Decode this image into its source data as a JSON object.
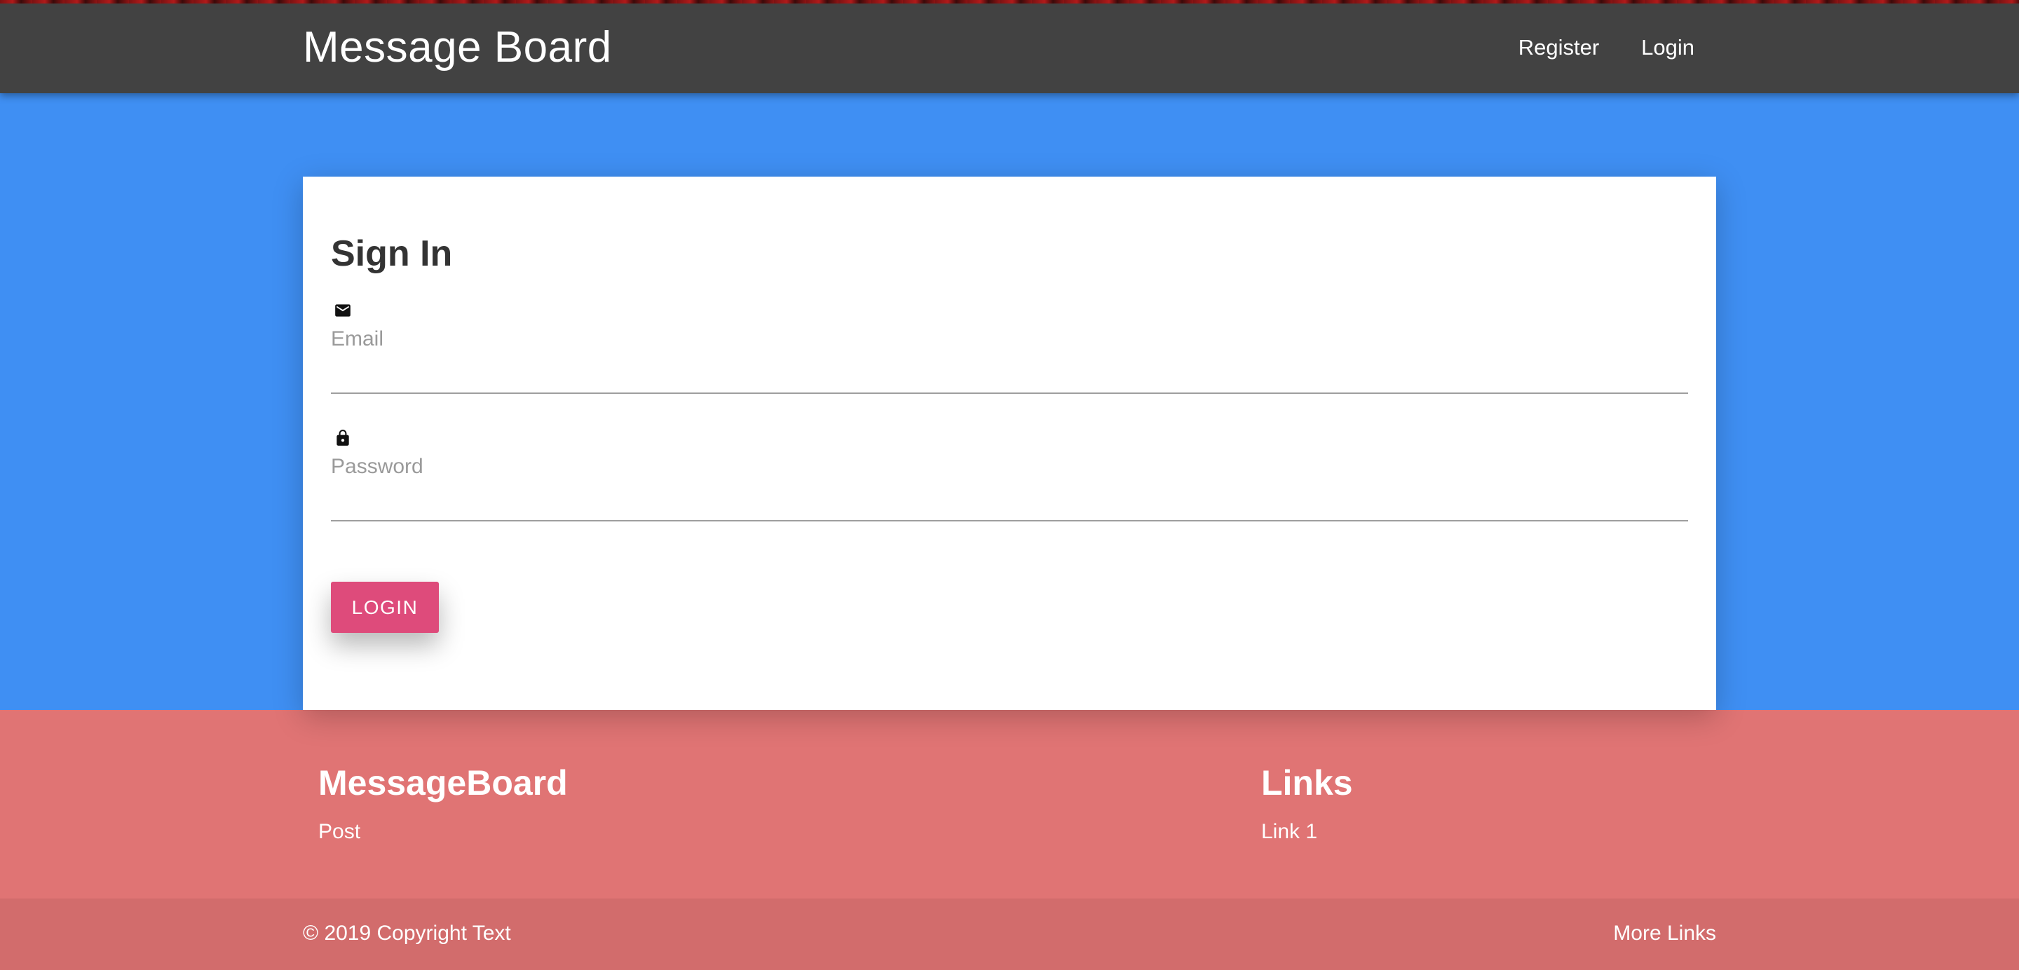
{
  "navbar": {
    "brand": "Message Board",
    "links": [
      "Register",
      "Login"
    ]
  },
  "card": {
    "title": "Sign In",
    "email": {
      "label": "Email",
      "value": "",
      "icon": "email-icon"
    },
    "password": {
      "label": "Password",
      "value": "",
      "icon": "lock-icon"
    },
    "login_button": "LOGIN"
  },
  "footer": {
    "left": {
      "title": "MessageBoard",
      "link": "Post"
    },
    "right": {
      "title": "Links",
      "link": "Link 1"
    },
    "copyright": "© 2019 Copyright Text",
    "more_links": "More Links"
  },
  "colors": {
    "navbar": "#424242",
    "hero": "#3f8ff3",
    "card": "#ffffff",
    "button": "#de4b7b",
    "footer": "#e07474",
    "footer_bottom": "#d26c6c"
  }
}
